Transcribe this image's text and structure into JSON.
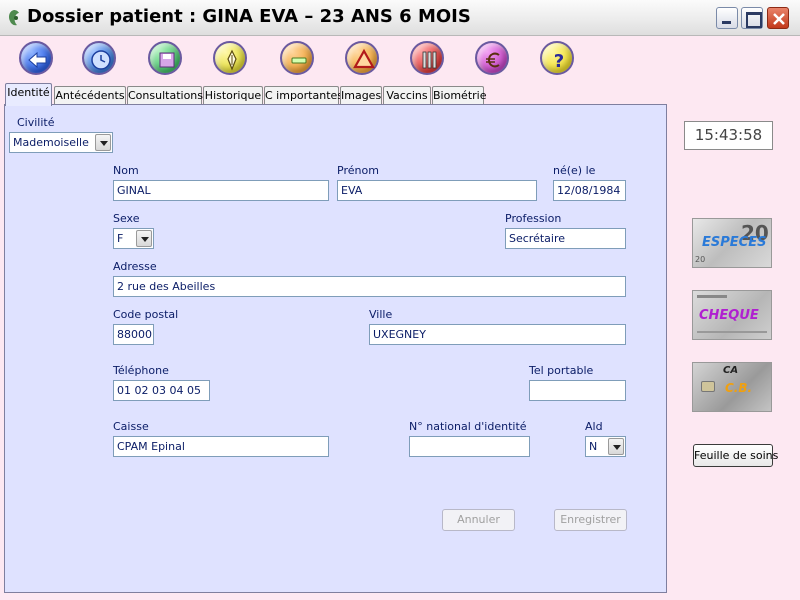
{
  "window": {
    "title": "Dossier patient : GINA EVA – 23 ANS 6 MOIS"
  },
  "toolbar": {
    "buttons": [
      {
        "icon": "back-arrow-icon",
        "color": "#2f62e6"
      },
      {
        "icon": "clock-icon",
        "color": "#3d7bd8"
      },
      {
        "icon": "save-icon",
        "color": "#45c06a"
      },
      {
        "icon": "pen-icon",
        "color": "#e4dc3a"
      },
      {
        "icon": "minus-icon",
        "color": "#f0a43a"
      },
      {
        "icon": "warning-triangle-icon",
        "color": "#f2a83c"
      },
      {
        "icon": "tools-icon",
        "color": "#dd3b3b"
      },
      {
        "icon": "euro-icon",
        "color": "#c848c8"
      },
      {
        "icon": "help-icon",
        "color": "#f0de30"
      }
    ]
  },
  "tabs": [
    "Identité",
    "Antécédents",
    "Consultations",
    "Historique",
    "C importantes",
    "Images",
    "Vaccins",
    "Biométrie"
  ],
  "form": {
    "civilite_label": "Civilité",
    "civilite_value": "Mademoiselle",
    "nom_label": "Nom",
    "nom_value": "GINAL",
    "prenom_label": "Prénom",
    "prenom_value": "EVA",
    "naissance_label": "né(e) le",
    "naissance_value": "12/08/1984",
    "sexe_label": "Sexe",
    "sexe_value": "F",
    "profession_label": "Profession",
    "profession_value": "Secrétaire",
    "adresse_label": "Adresse",
    "adresse_value": "2 rue des Abeilles",
    "cp_label": "Code postal",
    "cp_value": "88000",
    "ville_label": "Ville",
    "ville_value": "UXEGNEY",
    "tel_label": "Téléphone",
    "tel_value": "01 02 03 04 05",
    "portable_label": "Tel portable",
    "portable_value": "",
    "caisse_label": "Caisse",
    "caisse_value": "CPAM Epinal",
    "nni_label": "N° national d'identité",
    "nni_value": "",
    "ald_label": "Ald",
    "ald_value": "N",
    "annuler_label": "Annuler",
    "enregistrer_label": "Enregistrer"
  },
  "side": {
    "clock": "15:43:58",
    "especes_label": "ESPECES",
    "especes_note": "20",
    "cheque_label": "CHEQUE",
    "carte_label": "C.B.",
    "carte_brand": "CA",
    "feuille_label": "Feuille de soins"
  }
}
